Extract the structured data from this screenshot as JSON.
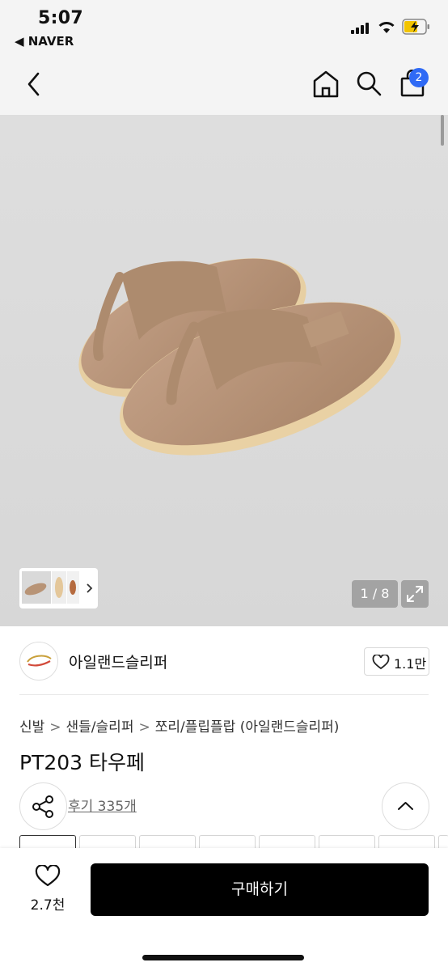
{
  "status_bar": {
    "time": "5:07",
    "back_app": "◀ NAVER"
  },
  "header": {
    "cart_count": "2"
  },
  "gallery": {
    "counter": "1 / 8"
  },
  "brand": {
    "name": "아일랜드슬리퍼",
    "likes": "1.1만"
  },
  "breadcrumb": [
    "신발",
    "샌들/슬리퍼",
    "쪼리/플립플랍 (아일랜드슬리퍼)"
  ],
  "product": {
    "title": "PT203 타우페",
    "reviews": "후기 335개"
  },
  "bottom_bar": {
    "wish_count": "2.7천",
    "buy_label": "구매하기"
  }
}
